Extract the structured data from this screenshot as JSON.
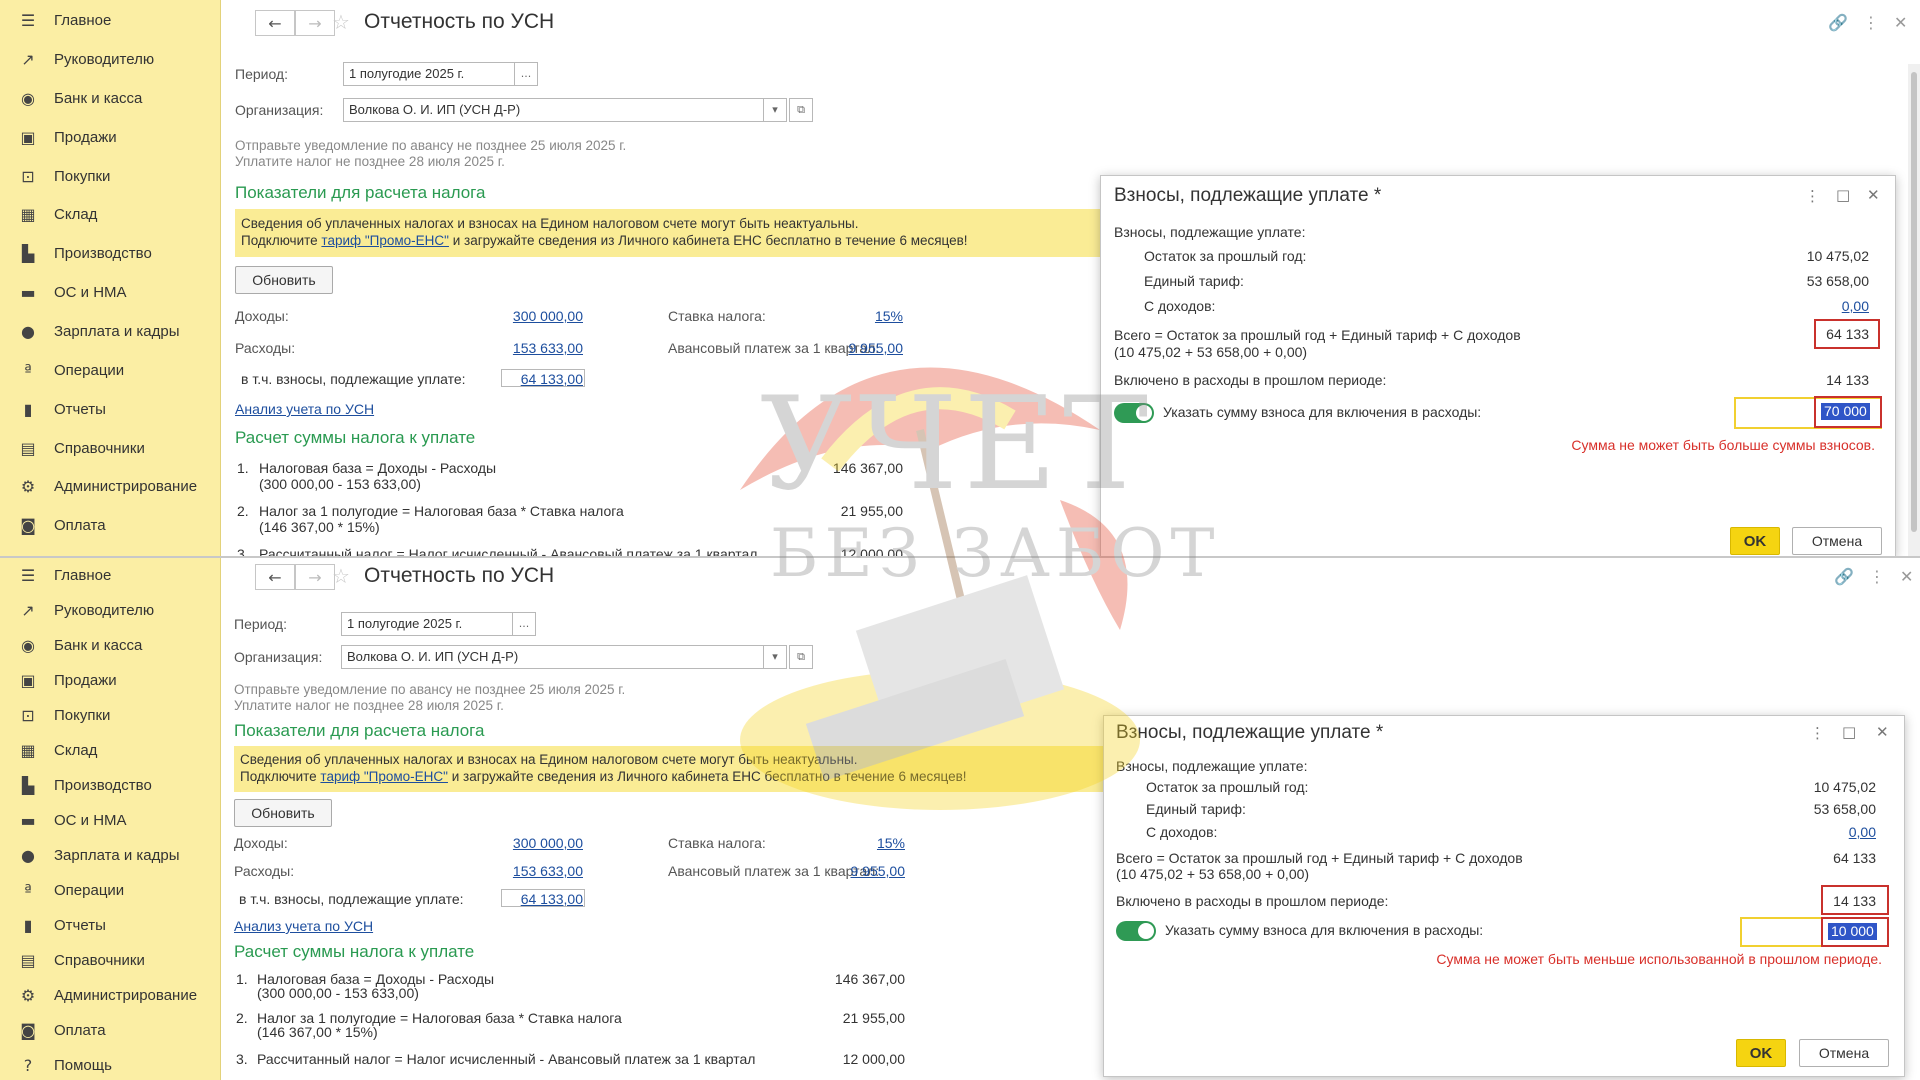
{
  "sidebar": {
    "items": [
      {
        "label": "Главное",
        "icon": "menu-icon",
        "glyph": "☰"
      },
      {
        "label": "Руководителю",
        "icon": "trend-chart-icon",
        "glyph": "↗"
      },
      {
        "label": "Банк и касса",
        "icon": "coin-icon",
        "glyph": "◉"
      },
      {
        "label": "Продажи",
        "icon": "shopping-bag-icon",
        "glyph": "▣"
      },
      {
        "label": "Покупки",
        "icon": "shopping-cart-icon",
        "glyph": "⊡"
      },
      {
        "label": "Склад",
        "icon": "warehouse-grid-icon",
        "glyph": "▦"
      },
      {
        "label": "Производство",
        "icon": "factory-icon",
        "glyph": "▙"
      },
      {
        "label": "ОС и НМА",
        "icon": "truck-icon",
        "glyph": "▬"
      },
      {
        "label": "Зарплата и кадры",
        "icon": "person-icon",
        "glyph": "●"
      },
      {
        "label": "Операции",
        "icon": "operations-icon",
        "glyph": "ª"
      },
      {
        "label": "Отчеты",
        "icon": "bar-chart-icon",
        "glyph": "▮"
      },
      {
        "label": "Справочники",
        "icon": "books-icon",
        "glyph": "▤"
      },
      {
        "label": "Администрирование",
        "icon": "gear-icon",
        "glyph": "⚙"
      },
      {
        "label": "Оплата",
        "icon": "payment-icon",
        "glyph": "◙"
      },
      {
        "label": "Помощь",
        "icon": "help-icon",
        "glyph": "?"
      }
    ]
  },
  "page": {
    "title": "Отчетность по УСН",
    "nav_back": "←",
    "nav_forward": "→",
    "star": "☆",
    "link_icon": "🔗",
    "more_icon": "⋮",
    "close_icon": "✕"
  },
  "form": {
    "period_label": "Период:",
    "period_value": "1 полугодие 2025 г.",
    "period_btn": "...",
    "org_label": "Организация:",
    "org_value": "Волкова О. И. ИП (УСН Д-Р)",
    "dropdown_glyph": "▾",
    "open_glyph": "⧉",
    "notice_line1": "Отправьте уведомление по авансу не позднее 25 июля 2025 г.",
    "notice_line2": "Уплатите налог не позднее 28 июля 2025 г.",
    "section1": "Показатели для расчета налога",
    "warn_line1": "Сведения об уплаченных налогах и взносах на Едином налоговом счете могут быть неактуальны.",
    "warn_line2_pre": "Подключите ",
    "warn_line2_link": "тариф \"Промо-ЕНС\"",
    "warn_line2_post": " и загружайте сведения из Личного кабинета ЕНС бесплатно в течение 6 месяцев!",
    "refresh_btn": "Обновить",
    "income_label": "Доходы:",
    "income_value": "300 000,00",
    "expenses_label": "Расходы:",
    "expenses_value": "153 633,00",
    "contrib_label": "в т.ч. взносы, подлежащие уплате:",
    "contrib_value": "64 133,00",
    "rate_label": "Ставка налога:",
    "rate_value": "15%",
    "advance_label": "Авансовый платеж за 1 квартал:",
    "advance_value": "9 955,00",
    "analysis_link": "Анализ учета по УСН",
    "section2": "Расчет суммы налога к уплате",
    "calc1_num": "1.",
    "calc1_line1": "Налоговая база = Доходы - Расходы",
    "calc1_line2": "(300 000,00 - 153 633,00)",
    "calc1_value": "146 367,00",
    "calc2_num": "2.",
    "calc2_line1": "Налог за 1 полугодие = Налоговая база * Ставка налога",
    "calc2_line2": "(146 367,00 * 15%)",
    "calc2_value": "21 955,00",
    "calc3_num": "3.",
    "calc3_line1": "Рассчитанный налог = Налог исчисленный - Авансовый платеж за 1 квартал",
    "calc3_value": "12 000,00"
  },
  "dialog": {
    "title": "Взносы, подлежащие уплате *",
    "more_icon": "⋮",
    "maximize_icon": "□",
    "close_icon": "✕",
    "header": "Взносы, подлежащие уплате:",
    "prev_year_label": "Остаток за прошлый год:",
    "prev_year_value": "10 475,02",
    "tariff_label": "Единый тариф:",
    "tariff_value": "53 658,00",
    "income_label": "С доходов:",
    "income_value": "0,00",
    "total_line1": "Всего = Остаток за прошлый год + Единый тариф + С доходов",
    "total_line2": "(10 475,02 + 53 658,00 + 0,00)",
    "total_value": "64 133",
    "included_label": "Включено в расходы в прошлом периоде:",
    "included_value": "14 133",
    "toggle_label": "Указать сумму взноса для включения в расходы:",
    "ok_btn": "OK",
    "cancel_btn": "Отмена"
  },
  "top_case": {
    "input_value": "70 000",
    "error": "Сумма не может быть больше суммы взносов."
  },
  "bottom_case": {
    "input_value": "10 000",
    "error": "Сумма не может быть меньше использованной в прошлом периоде."
  },
  "watermark": {
    "line1": "УЧЕТ",
    "line2": "БЕЗ ЗАБОТ"
  }
}
